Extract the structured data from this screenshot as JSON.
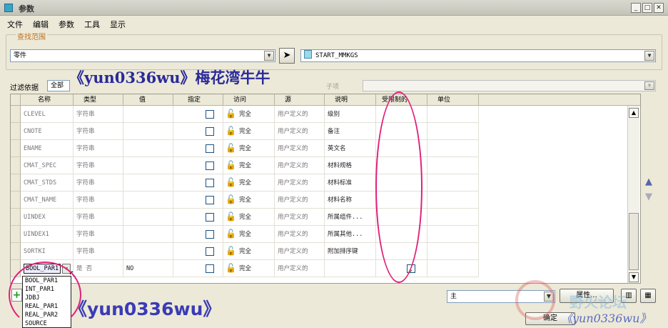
{
  "window": {
    "title": "参数"
  },
  "menu": [
    "文件",
    "编辑",
    "参数",
    "工具",
    "显示"
  ],
  "scope": {
    "label": "查找范围",
    "type_value": "零件",
    "model_value": "START_MMKGS"
  },
  "filter": {
    "label": "过滤依据",
    "value": "全部",
    "sub_label": "子项"
  },
  "columns": [
    "名称",
    "类型",
    "值",
    "指定",
    "访问",
    "源",
    "说明",
    "受限制的",
    "单位"
  ],
  "rows": [
    {
      "name": "CLEVEL",
      "type": "字符串",
      "value": "",
      "designate": false,
      "access": "完全",
      "source": "用户定义的",
      "desc": "级别",
      "restricted": false
    },
    {
      "name": "CNOTE",
      "type": "字符串",
      "value": "",
      "designate": false,
      "access": "完全",
      "source": "用户定义的",
      "desc": "备注",
      "restricted": false
    },
    {
      "name": "ENAME",
      "type": "字符串",
      "value": "",
      "designate": false,
      "access": "完全",
      "source": "用户定义的",
      "desc": "英文名",
      "restricted": false
    },
    {
      "name": "CMAT_SPEC",
      "type": "字符串",
      "value": "",
      "designate": false,
      "access": "完全",
      "source": "用户定义的",
      "desc": "材料规格",
      "restricted": false
    },
    {
      "name": "CMAT_STDS",
      "type": "字符串",
      "value": "",
      "designate": false,
      "access": "完全",
      "source": "用户定义的",
      "desc": "材料标准",
      "restricted": false
    },
    {
      "name": "CMAT_NAME",
      "type": "字符串",
      "value": "",
      "designate": false,
      "access": "完全",
      "source": "用户定义的",
      "desc": "材料名称",
      "restricted": false
    },
    {
      "name": "UINDEX",
      "type": "字符串",
      "value": "",
      "designate": false,
      "access": "完全",
      "source": "用户定义的",
      "desc": "所属组件...",
      "restricted": false
    },
    {
      "name": "UINDEX1",
      "type": "字符串",
      "value": "",
      "designate": false,
      "access": "完全",
      "source": "用户定义的",
      "desc": "所属其他...",
      "restricted": false
    },
    {
      "name": "SORTKI",
      "type": "字符串",
      "value": "",
      "designate": false,
      "access": "完全",
      "source": "用户定义的",
      "desc": "附加排序键",
      "restricted": false
    },
    {
      "name": "BOOL_PAR1",
      "type": "是 否",
      "value": "NO",
      "designate": false,
      "access": "完全",
      "source": "用户定义的",
      "desc": "",
      "restricted": true
    }
  ],
  "type_dropdown": [
    "BOOL_PAR1",
    "INT_PAR1",
    "JDBJ",
    "REAL_PAR1",
    "REAL_PAR2",
    "SOURCE"
  ],
  "bottom": {
    "select_value": "主",
    "props_button": "属性...",
    "ok_button": "确定"
  },
  "watermarks": {
    "top": "《yun0336wu》梅花湾牛牛",
    "bottom": "《yun0336wu》",
    "corner": "《yun0336wu》",
    "corner_site": "野火论坛"
  },
  "colors": {
    "highlight": "#e0207a",
    "watermark": "#3b3bb5"
  }
}
